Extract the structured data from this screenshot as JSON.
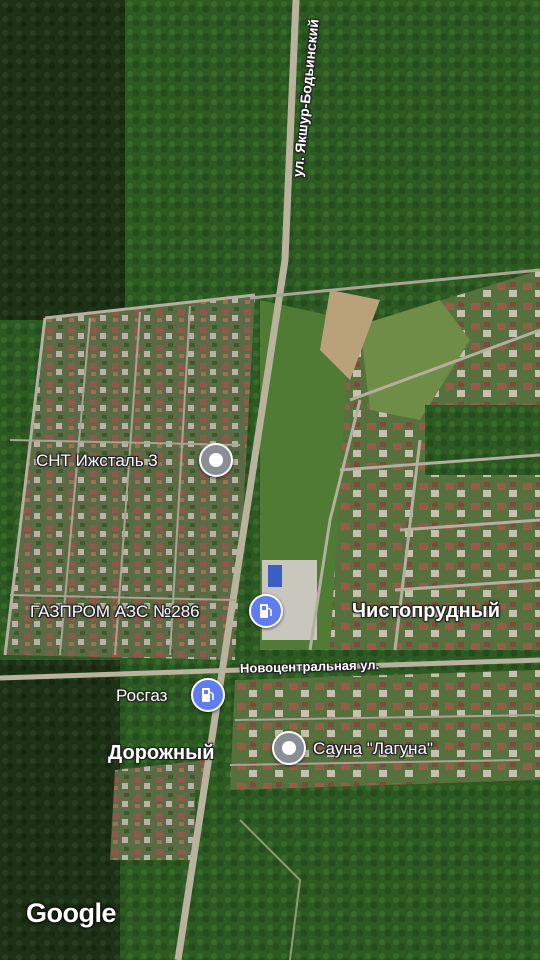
{
  "map": {
    "streets": {
      "vertical": "ул. Якшур-Бодьинский",
      "horizontal": "Новоцентральная ул."
    },
    "places": [
      {
        "name": "Чистопрудный"
      },
      {
        "name": "Дорожный"
      }
    ],
    "pois": [
      {
        "label": "СНТ Ижсталь 3",
        "icon": "place-pin-icon"
      },
      {
        "label": "ГАЗПРОМ АЗС №286",
        "icon": "fuel-station-icon"
      },
      {
        "label": "Росгаз",
        "icon": "fuel-station-icon"
      },
      {
        "label": "Сауна \"Лагуна\"",
        "icon": "place-pin-icon"
      }
    ],
    "attribution": "Google",
    "colors": {
      "forest": "#2f5a24",
      "forest_dark": "#1f3318",
      "field": "#4d7a34",
      "road": "#b9b29c",
      "pin_gray": "#8a8f96",
      "pin_blue": "#5f7cf0"
    }
  }
}
